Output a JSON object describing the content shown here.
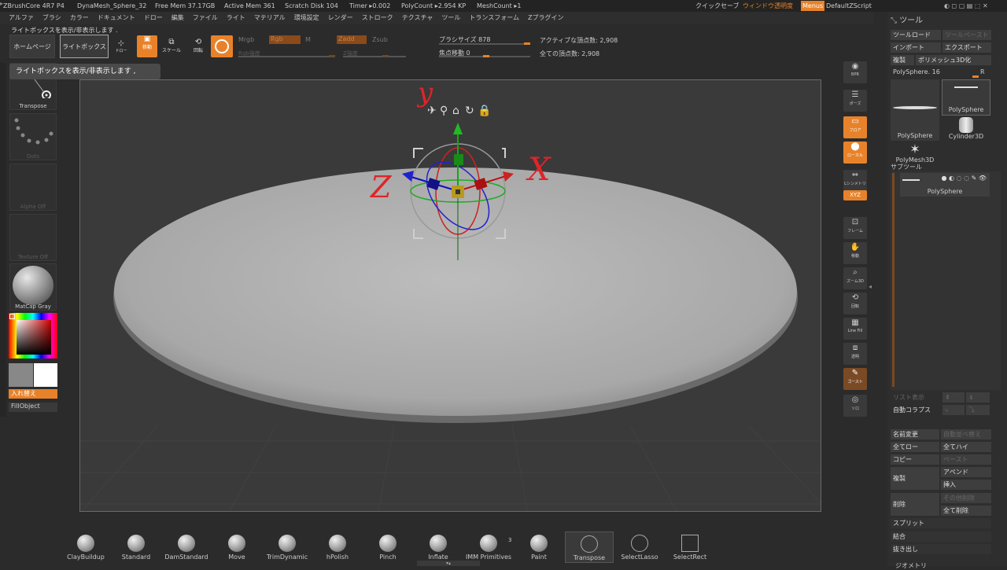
{
  "titlebar": {
    "app": "ZBrushCore 4R7 P4",
    "document": "DynaMesh_Sphere_32",
    "free_mem": "Free Mem 37.17GB",
    "active_mem": "Active Mem 361",
    "scratch": "Scratch Disk 104",
    "timer": "Timer ▸0.002",
    "polycount": "PolyCount ▸2.954 KP",
    "meshcount": "MeshCount ▸1",
    "quicksave": "クイックセーブ",
    "transparency": "ウィンドウ透明度",
    "menus": "Menus",
    "script": "DefaultZScript"
  },
  "menu": [
    "アルファ",
    "ブラシ",
    "カラー",
    "ドキュメント",
    "ドロー",
    "編集",
    "ファイル",
    "ライト",
    "マテリアル",
    "環境設定",
    "レンダー",
    "ストローク",
    "テクスチャ",
    "ツール",
    "トランスフォーム",
    "Zプラグイン"
  ],
  "hint": "ライトボックスを表示/非表示します .",
  "tooltip": "ライトボックスを表示/非表示します ,",
  "toolbar": {
    "home": "ホームページ",
    "lightbox": "ライトボックス",
    "draw": "ドロー",
    "move": "移動",
    "scale": "スケール",
    "rotate": "回転",
    "mrgb": "Mrgb",
    "rgb": "Rgb",
    "m": "M",
    "zadd": "Zadd",
    "zsub": "Zsub",
    "rgb_intensity": "Rgb強度",
    "z_intensity": "Z強度",
    "brush_size": "ブラシサイズ 878",
    "focal_shift": "焦点移動 0",
    "active_points": "アクティブな頂点数: 2,908",
    "total_points": "全ての頂点数: 2,908"
  },
  "left": {
    "transpose": "Transpose",
    "dots": "Dots",
    "alpha": "Alpha Off",
    "texture": "Texture Off",
    "matcap": "MatCap Gray",
    "swap": "入れ替え",
    "fill": "FillObject"
  },
  "annotations": {
    "y": "y",
    "x": "X",
    "z": "Z"
  },
  "right": [
    "BPR",
    "ポーズ",
    "フロア",
    "ローカル",
    "Lシンメトリ",
    "XYZ",
    "フレーム",
    "移動",
    "ズーム3D",
    "回転",
    "Line Fill",
    "PolyF",
    "透明",
    "ゴースト",
    "ソロ"
  ],
  "tool": {
    "title": "ツール",
    "load": "ツールロード",
    "save": "ツールペースト",
    "import": "インポート",
    "export": "エクスポート",
    "clone": "複製",
    "make3d": "ポリメッシュ3D化",
    "polysphere": "PolySphere. 16",
    "r": "R",
    "items": [
      "PolySphere",
      "PolySphere",
      "Cylinder3D",
      "PolyMesh3D"
    ],
    "subtool": "サブツール",
    "subtool_item": "PolySphere",
    "list_all": "リスト表示",
    "auto_collapse": "自動コラプス",
    "rename": "名前変更",
    "auto_reorder": "自動並べ替え",
    "all_low": "全てロー",
    "all_high": "全てハイ",
    "copy": "コピー",
    "paste": "ペースト",
    "duplicate": "複製",
    "append": "アペンド",
    "insert": "挿入",
    "delete": "削除",
    "del_other": "その他削除",
    "del_all": "全て削除",
    "split": "スプリット",
    "merge": "結合",
    "extract": "抜き出し",
    "geometry": "ジオメトリ"
  },
  "brushes": [
    "ClayBuildup",
    "Standard",
    "DamStandard",
    "Move",
    "TrimDynamic",
    "hPolish",
    "Pinch",
    "Inflate",
    "IMM Primitives",
    "Paint",
    "Transpose",
    "SelectLasso",
    "SelectRect"
  ],
  "imm_count": "3",
  "colors": {
    "accent": "#e8822a",
    "annotation": "#e0242a"
  }
}
